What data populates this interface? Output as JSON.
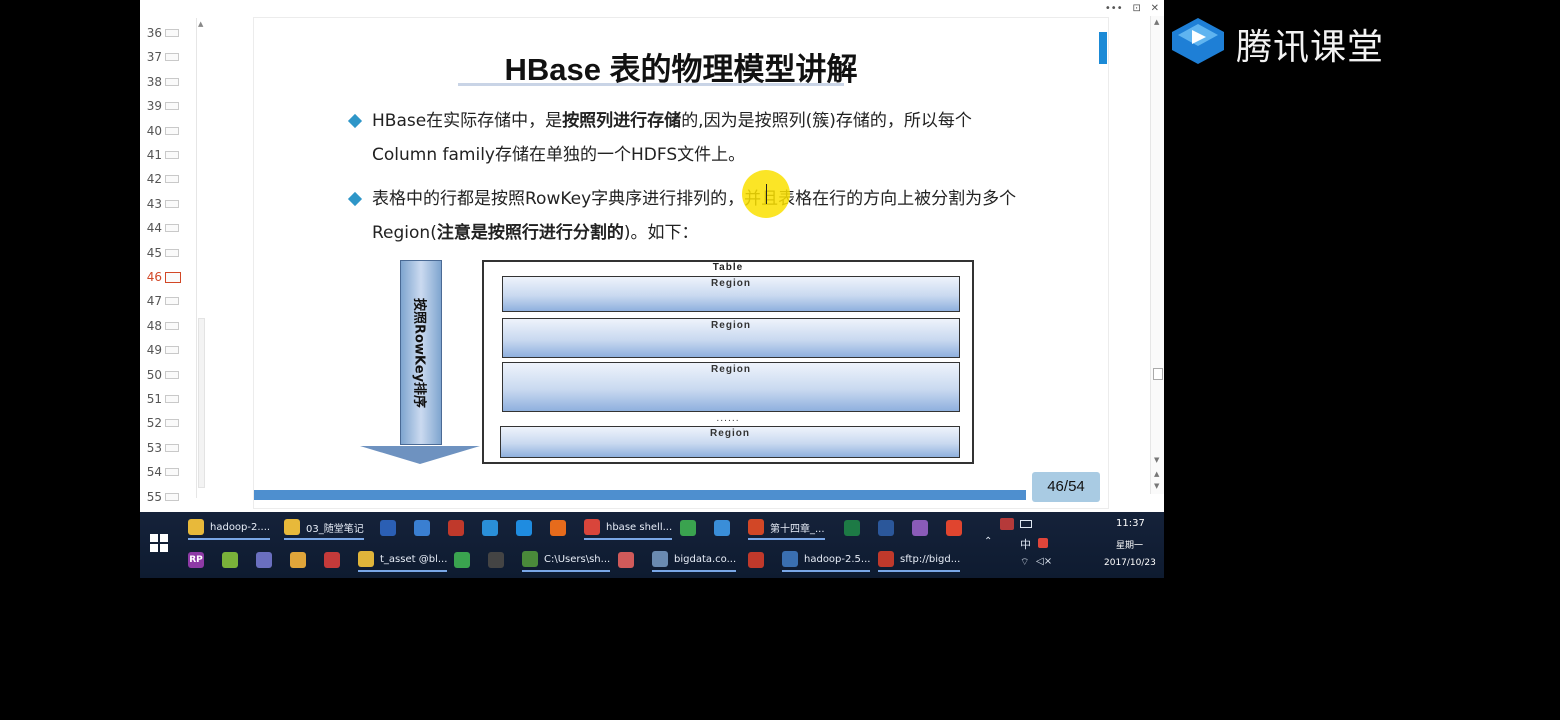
{
  "slide": {
    "title": "HBase 表的物理模型讲解",
    "bullet1_part1": "HBase在实际存储中，是",
    "bullet1_bold": "按照列进行存储",
    "bullet1_part2": "的,因为是按照列(簇)存储的，所以每个Column family存储在单独的一个HDFS文件上。",
    "bullet2_part1": "表格中的行都是按照RowKey字典序进行排列的，并且表格在行的方向上被分割为多个Region(",
    "bullet2_bold": "注意是按照行进行分割的",
    "bullet2_part2": ")。如下：",
    "arrow_label": "按照RowKey排序",
    "table_label": "Table",
    "regions": [
      "Region",
      "Region",
      "Region",
      "Region"
    ],
    "region_ellipsis": "......",
    "page_counter": "46/54"
  },
  "thumbnails": {
    "numbers": [
      "36",
      "37",
      "38",
      "39",
      "40",
      "41",
      "42",
      "43",
      "44",
      "45",
      "46",
      "47",
      "48",
      "49",
      "50",
      "51",
      "52",
      "53",
      "54",
      "55"
    ],
    "active": "46"
  },
  "window_controls": [
    "•••",
    "⊡",
    "✕"
  ],
  "taskbar": {
    "top_row": [
      {
        "label": "hadoop-2....",
        "icon": "folder-icon",
        "color": "#e8b93a"
      },
      {
        "label": "03_随堂笔记",
        "icon": "folder-icon",
        "color": "#e8b93a"
      },
      {
        "label": "",
        "icon": "app-g-icon",
        "color": "#2b5fb4"
      },
      {
        "label": "",
        "icon": "app-network-icon",
        "color": "#3a7fd1"
      },
      {
        "label": "",
        "icon": "java-icon",
        "color": "#c0392b"
      },
      {
        "label": "",
        "icon": "app-k-icon",
        "color": "#2a8fd8"
      },
      {
        "label": "",
        "icon": "ie-icon",
        "color": "#1f8ce0"
      },
      {
        "label": "",
        "icon": "firefox-icon",
        "color": "#e66b1c"
      },
      {
        "label": "hbase shell...",
        "icon": "chrome-icon",
        "color": "#d9453b"
      },
      {
        "label": "",
        "icon": "app-green-icon",
        "color": "#3aa34f"
      },
      {
        "label": "",
        "icon": "app-bird-icon",
        "color": "#3a8ed8"
      },
      {
        "label": "第十四章_...",
        "icon": "powerpoint-icon",
        "color": "#d24726"
      },
      {
        "label": "",
        "icon": "excel-icon",
        "color": "#1d7a45"
      },
      {
        "label": "",
        "icon": "word-icon",
        "color": "#2b579a"
      },
      {
        "label": "",
        "icon": "app-books-icon",
        "color": "#8a5bb8"
      },
      {
        "label": "",
        "icon": "xmind-icon",
        "color": "#e0452f"
      }
    ],
    "bottom_row": [
      {
        "label": "",
        "icon": "rp-icon",
        "color": "#8e3aa6",
        "text": "RP"
      },
      {
        "label": "",
        "icon": "app-circle-icon",
        "color": "#7ab23a"
      },
      {
        "label": "",
        "icon": "app-globe-icon",
        "color": "#6a6fbf"
      },
      {
        "label": "",
        "icon": "app-cup-icon",
        "color": "#e0a53a"
      },
      {
        "label": "",
        "icon": "app-cube-icon",
        "color": "#c43a3a"
      },
      {
        "label": "t_asset @bl...",
        "icon": "navicat-icon",
        "color": "#e0b53a"
      },
      {
        "label": "",
        "icon": "app-pc-icon",
        "color": "#3aa34f"
      },
      {
        "label": "",
        "icon": "intellij-icon",
        "color": "#444"
      },
      {
        "label": "C:\\Users\\sh...",
        "icon": "terminal-icon",
        "color": "#4a8a3a"
      },
      {
        "label": "",
        "icon": "app-eraser-icon",
        "color": "#d05a5a"
      },
      {
        "label": "bigdata.co...",
        "icon": "app-window-icon",
        "color": "#6a8ab0"
      },
      {
        "label": "",
        "icon": "filezilla-icon",
        "color": "#c0392b"
      },
      {
        "label": "hadoop-2.5...",
        "icon": "app-box-icon",
        "color": "#3a6fb0"
      },
      {
        "label": "sftp://bigd...",
        "icon": "filezilla-icon",
        "color": "#c0392b"
      }
    ],
    "tray": {
      "ime": "中",
      "time": "11:37",
      "day": "星期一",
      "date": "2017/10/23"
    }
  },
  "logo": {
    "text": "腾讯课堂"
  }
}
